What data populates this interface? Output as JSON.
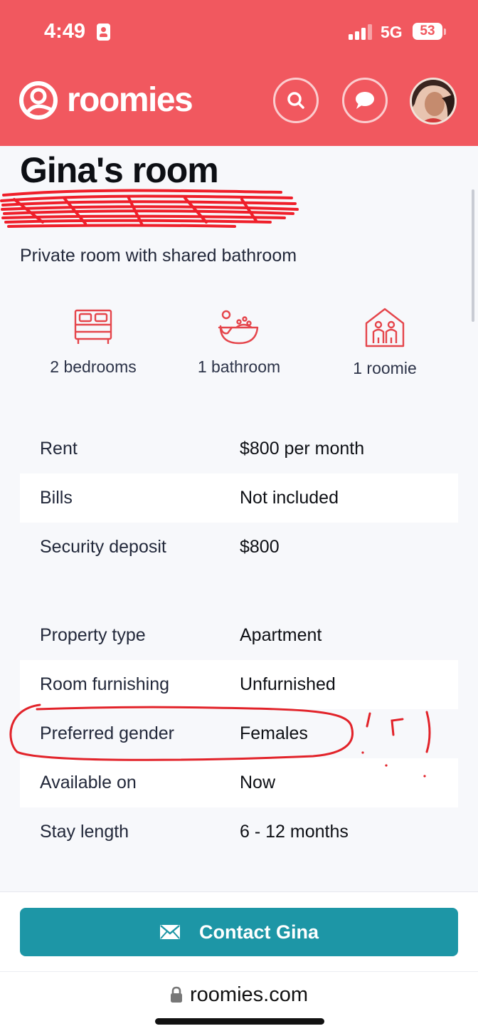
{
  "status_bar": {
    "time": "4:49",
    "network": "5G",
    "battery": "53"
  },
  "header": {
    "brand": "roomies",
    "icons": [
      "search-icon",
      "chat-icon",
      "avatar"
    ],
    "brand_color": "#f1585f"
  },
  "listing": {
    "title": "Gina's room",
    "subtitle": "Private room with shared bathroom",
    "features": [
      {
        "icon": "bed-icon",
        "label": "2 bedrooms"
      },
      {
        "icon": "bathtub-icon",
        "label": "1 bathroom"
      },
      {
        "icon": "house-people-icon",
        "label": "1 roomie"
      }
    ],
    "costs": [
      {
        "key": "Rent",
        "value": "$800 per month"
      },
      {
        "key": "Bills",
        "value": "Not included"
      },
      {
        "key": "Security deposit",
        "value": "$800"
      }
    ],
    "details": [
      {
        "key": "Property type",
        "value": "Apartment"
      },
      {
        "key": "Room furnishing",
        "value": "Unfurnished"
      },
      {
        "key": "Preferred gender",
        "value": "Females"
      },
      {
        "key": "Available on",
        "value": "Now"
      },
      {
        "key": "Stay length",
        "value": "6 - 12 months"
      }
    ]
  },
  "actions": {
    "contact_label": "Contact Gina",
    "contact_color": "#1d96a6"
  },
  "browser": {
    "url": "roomies.com"
  }
}
